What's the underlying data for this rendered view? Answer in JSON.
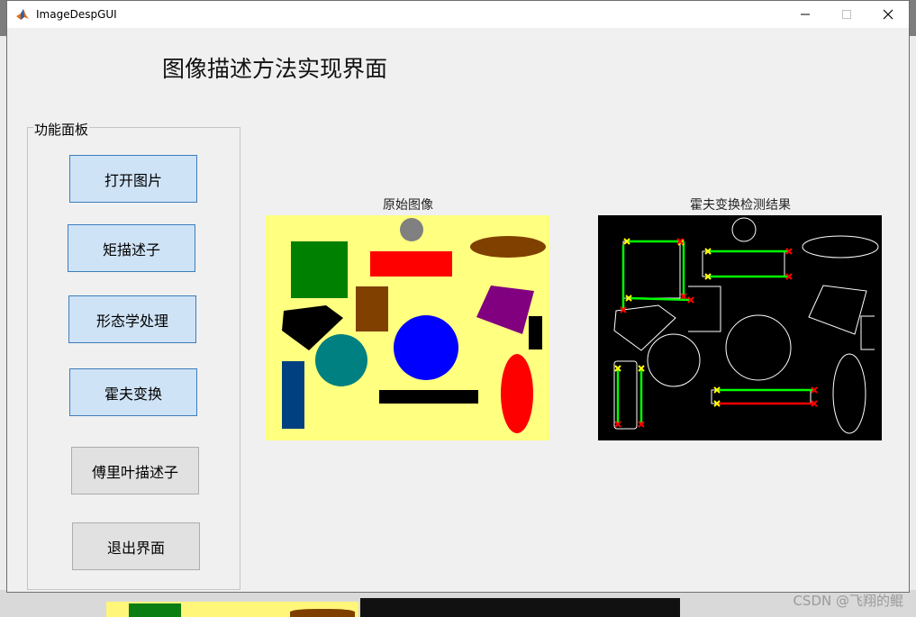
{
  "window": {
    "title": "ImageDespGUI",
    "controls": {
      "minimize": "—",
      "maximize": "☐",
      "close": "✕"
    }
  },
  "main": {
    "title": "图像描述方法实现界面"
  },
  "panel": {
    "title": "功能面板",
    "buttons": [
      {
        "label": "打开图片"
      },
      {
        "label": "矩描述子"
      },
      {
        "label": "形态学处理"
      },
      {
        "label": "霍夫变换"
      },
      {
        "label": "傅里叶描述子"
      },
      {
        "label": "退出界面"
      }
    ]
  },
  "axes": {
    "original": {
      "title": "原始图像"
    },
    "result": {
      "title": "霍夫变换检测结果"
    }
  },
  "background": {
    "watermark": "CSDN @飞翔的鲲"
  },
  "colors": {
    "button_blue": "#cfe3f7",
    "button_gray": "#e1e1e1",
    "original_bg": "#ffff80",
    "hough_line": "#00ff00",
    "hough_start": "#ffff00",
    "hough_end": "#ff0000"
  }
}
